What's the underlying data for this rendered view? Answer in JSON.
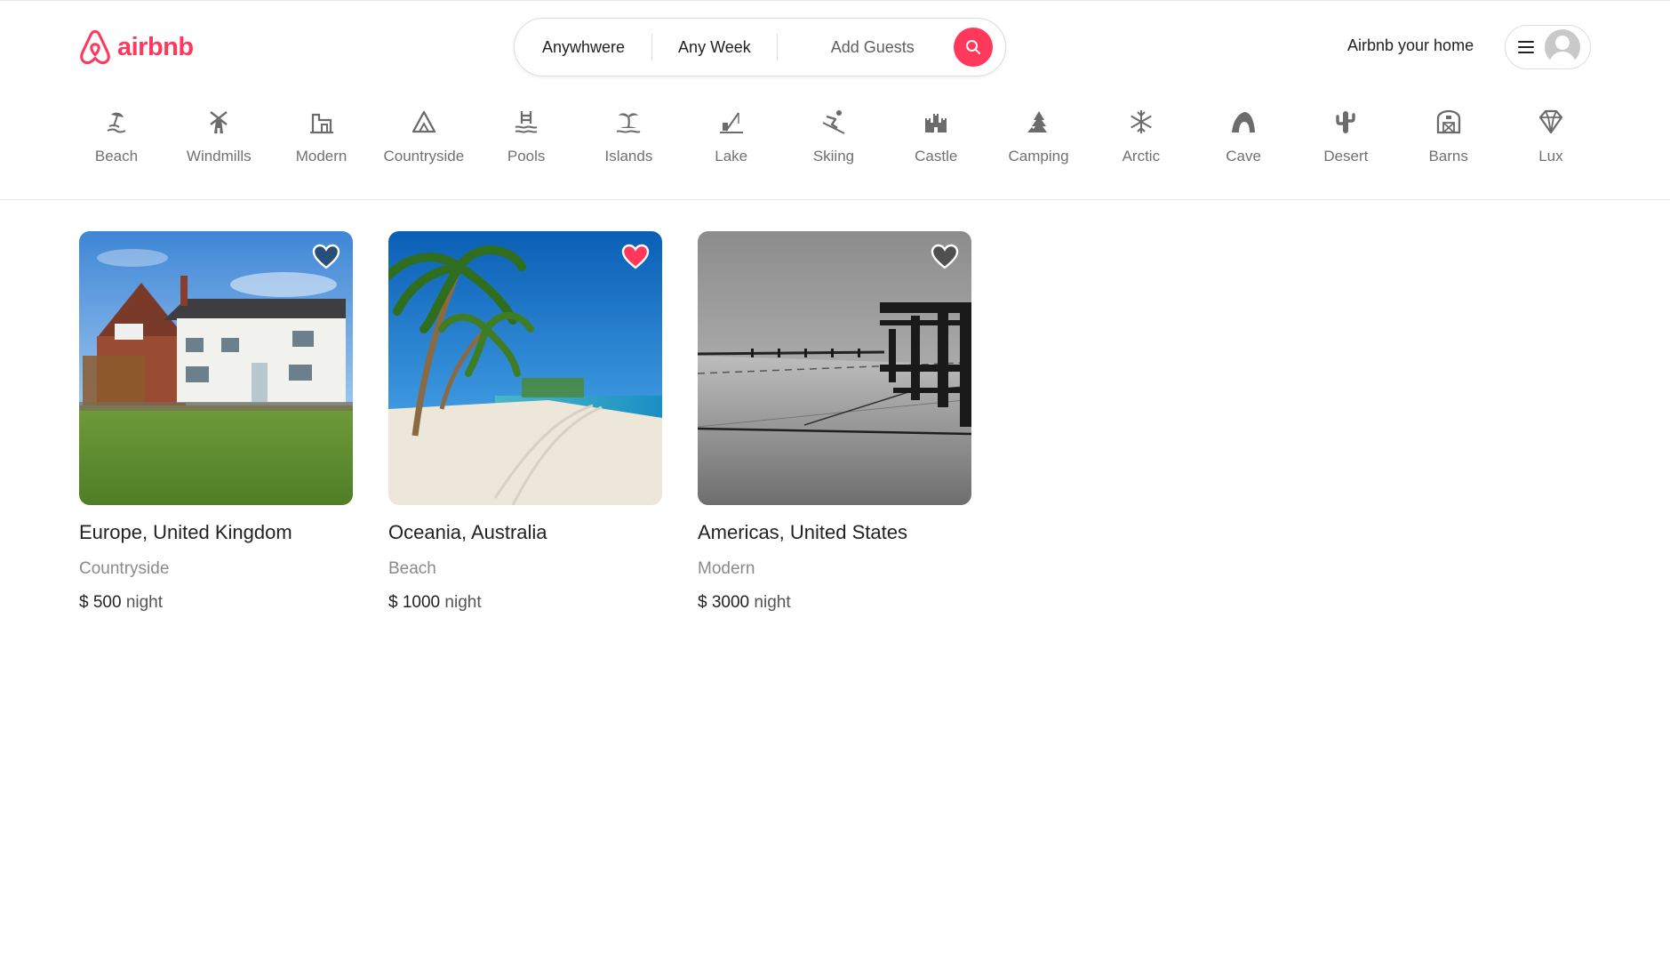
{
  "brand": {
    "name": "airbnb",
    "color": "#ff385c",
    "icon": "airbnb-logo-icon"
  },
  "search": {
    "where": "Anywhwere",
    "when": "Any Week",
    "guests": "Add Guests",
    "button_icon": "search-icon"
  },
  "header": {
    "host_link": "Airbnb your home",
    "menu_icon": "hamburger-menu-icon",
    "avatar_icon": "user-avatar-icon"
  },
  "categories": [
    {
      "label": "Beach",
      "icon": "beach-icon"
    },
    {
      "label": "Windmills",
      "icon": "windmill-icon"
    },
    {
      "label": "Modern",
      "icon": "modern-house-icon"
    },
    {
      "label": "Countryside",
      "icon": "mountain-icon"
    },
    {
      "label": "Pools",
      "icon": "pool-icon"
    },
    {
      "label": "Islands",
      "icon": "island-icon"
    },
    {
      "label": "Lake",
      "icon": "lake-fishing-icon"
    },
    {
      "label": "Skiing",
      "icon": "skiing-icon"
    },
    {
      "label": "Castle",
      "icon": "castle-icon"
    },
    {
      "label": "Camping",
      "icon": "camping-tent-icon"
    },
    {
      "label": "Arctic",
      "icon": "snowflake-icon"
    },
    {
      "label": "Cave",
      "icon": "cave-icon"
    },
    {
      "label": "Desert",
      "icon": "cactus-icon"
    },
    {
      "label": "Barns",
      "icon": "barn-icon"
    },
    {
      "label": "Lux",
      "icon": "diamond-icon"
    }
  ],
  "listings": [
    {
      "title": "Europe, United Kingdom",
      "type": "Countryside",
      "price": "$ 500",
      "unit": "night",
      "favorited": false,
      "image": "country-house-photo"
    },
    {
      "title": "Oceania, Australia",
      "type": "Beach",
      "price": "$ 1000",
      "unit": "night",
      "favorited": true,
      "image": "tropical-beach-photo"
    },
    {
      "title": "Americas, United States",
      "type": "Modern",
      "price": "$ 3000",
      "unit": "night",
      "favorited": false,
      "image": "modern-building-bw-photo"
    }
  ],
  "colors": {
    "accent": "#ff385c",
    "muted_text": "#717171",
    "border": "#dddddd"
  }
}
